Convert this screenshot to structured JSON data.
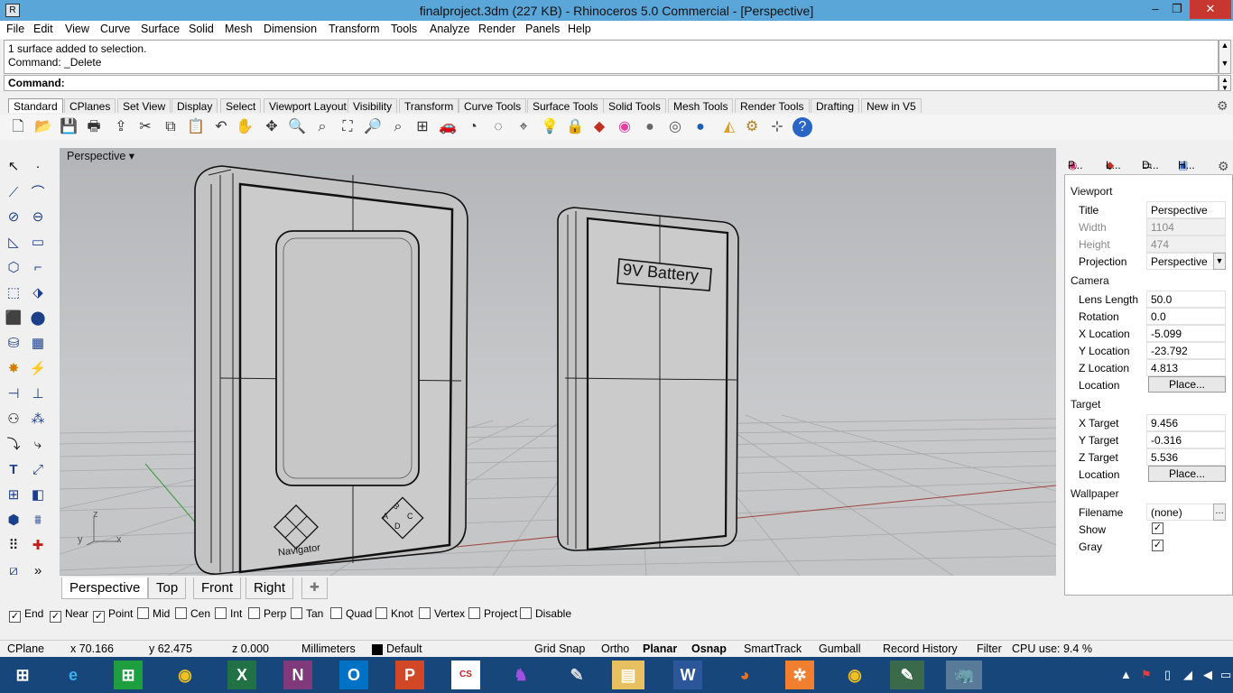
{
  "window": {
    "title": "finalproject.3dm (227 KB) - Rhinoceros 5.0 Commercial - [Perspective]",
    "minimize": "–",
    "restore": "❐",
    "close": "✕"
  },
  "menu": [
    "File",
    "Edit",
    "View",
    "Curve",
    "Surface",
    "Solid",
    "Mesh",
    "Dimension",
    "Transform",
    "Tools",
    "Analyze",
    "Render",
    "Panels",
    "Help"
  ],
  "command_history": [
    "1 surface added to selection.",
    "Command: _Delete"
  ],
  "command_prompt": "Command:",
  "toolbar_tabs": [
    "Standard",
    "CPlanes",
    "Set View",
    "Display",
    "Select",
    "Viewport Layout",
    "Visibility",
    "Transform",
    "Curve Tools",
    "Surface Tools",
    "Solid Tools",
    "Mesh Tools",
    "Render Tools",
    "Drafting",
    "New in V5"
  ],
  "toolbar_icons": [
    "new-icon",
    "open-icon",
    "save-icon",
    "print-icon",
    "import-icon",
    "cut-icon",
    "copy-icon",
    "paste-icon",
    "undo-icon",
    "pan-icon",
    "rotate-icon",
    "zoom-icon",
    "zoom-window-icon",
    "zoom-extents-icon",
    "zoom-selected-icon",
    "zoom-dynamic-icon",
    "four-viewports-icon",
    "car-icon",
    "shaded-icon",
    "ghosted-icon",
    "snap-icon",
    "light-icon",
    "lock-icon",
    "layer-icon",
    "color-wheel-icon",
    "rendered-sphere-icon",
    "render-icon",
    "render-preview-icon",
    "sun-icon",
    "settings-icon",
    "options-icon",
    "help-icon"
  ],
  "viewport": {
    "label": "Perspective",
    "device_left_text": "Navigator",
    "device_right_text": "9V Battery",
    "abcd": [
      "A",
      "B",
      "C",
      "D"
    ],
    "axis_x": "x",
    "axis_y": "y",
    "axis_z": "z"
  },
  "viewport_tabs": [
    "Perspective",
    "Top",
    "Front",
    "Right"
  ],
  "panel": {
    "tabs": [
      "P...",
      "L...",
      "D...",
      "H..."
    ],
    "viewport_header": "Viewport",
    "viewport_rows": [
      {
        "label": "Title",
        "value": "Perspective"
      },
      {
        "label": "Width",
        "value": "1104"
      },
      {
        "label": "Height",
        "value": "474"
      },
      {
        "label": "Projection",
        "value": "Perspective"
      }
    ],
    "camera_header": "Camera",
    "camera_rows": [
      {
        "label": "Lens Length",
        "value": "50.0"
      },
      {
        "label": "Rotation",
        "value": "0.0"
      },
      {
        "label": "X Location",
        "value": "-5.099"
      },
      {
        "label": "Y Location",
        "value": "-23.792"
      },
      {
        "label": "Z Location",
        "value": "4.813"
      },
      {
        "label": "Location",
        "value": "Place..."
      }
    ],
    "target_header": "Target",
    "target_rows": [
      {
        "label": "X Target",
        "value": "9.456"
      },
      {
        "label": "Y Target",
        "value": "-0.316"
      },
      {
        "label": "Z Target",
        "value": "5.536"
      },
      {
        "label": "Location",
        "value": "Place..."
      }
    ],
    "wallpaper_header": "Wallpaper",
    "wallpaper_rows": [
      {
        "label": "Filename",
        "value": "(none)"
      },
      {
        "label": "Show",
        "value": "✓"
      },
      {
        "label": "Gray",
        "value": "✓"
      }
    ]
  },
  "osnaps": [
    {
      "label": "End",
      "checked": "✓"
    },
    {
      "label": "Near",
      "checked": "✓"
    },
    {
      "label": "Point",
      "checked": "✓"
    },
    {
      "label": "Mid",
      "checked": ""
    },
    {
      "label": "Cen",
      "checked": ""
    },
    {
      "label": "Int",
      "checked": ""
    },
    {
      "label": "Perp",
      "checked": ""
    },
    {
      "label": "Tan",
      "checked": ""
    },
    {
      "label": "Quad",
      "checked": ""
    },
    {
      "label": "Knot",
      "checked": ""
    },
    {
      "label": "Vertex",
      "checked": ""
    },
    {
      "label": "Project",
      "checked": ""
    },
    {
      "label": "Disable",
      "checked": ""
    }
  ],
  "statusbar": {
    "cplane": "CPlane",
    "x": "x 70.166",
    "y": "y 62.475",
    "z": "z 0.000",
    "units": "Millimeters",
    "layer": "Default",
    "grid_snap": "Grid Snap",
    "ortho": "Ortho",
    "planar": "Planar",
    "osnap": "Osnap",
    "smarttrack": "SmartTrack",
    "gumball": "Gumball",
    "record_history": "Record History",
    "filter": "Filter",
    "cpu": "CPU use: 9.4 %"
  },
  "taskbar": [
    "windows-start-icon",
    "ie-icon",
    "store-icon",
    "chrome-icon",
    "excel-icon",
    "onenote-icon",
    "outlook-icon",
    "powerpoint-icon",
    "cs-eagle-icon",
    "app-purple-icon",
    "paint-icon",
    "explorer-icon",
    "word-icon",
    "firefox-icon",
    "app-orange-icon",
    "chrome2-icon",
    "notepad-icon",
    "rhino-icon"
  ],
  "colors": {
    "titlebar": "#5ba6d9",
    "taskbar": "#16467a",
    "close": "#c7372f"
  }
}
